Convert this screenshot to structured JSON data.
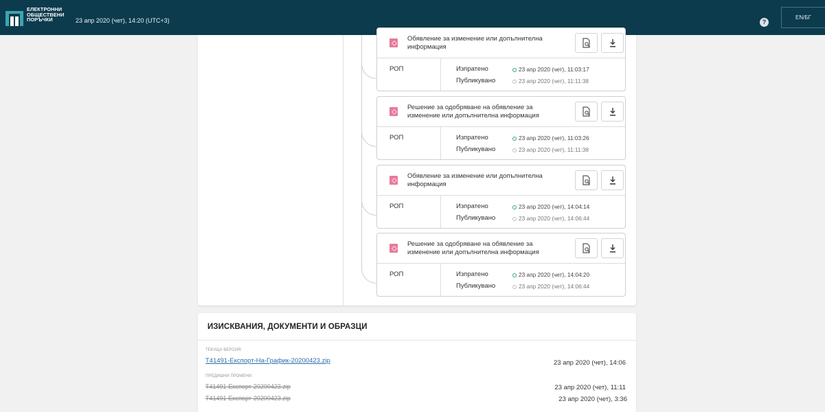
{
  "header": {
    "logo_lines": [
      "ЕЛЕКТРОННИ",
      "ОБЩЕСТВЕНИ",
      "ПОРЪЧКИ"
    ],
    "datetime": "23 апр 2020 (чет), 14:20 (UTC+3)",
    "help_icon": "question-circle-icon",
    "lang": "EN/БГ",
    "bg_color": "#0c3b4d"
  },
  "timeline": {
    "sent_label": "Изпратено",
    "published_label": "Публикувано",
    "documents": [
      {
        "title": "Обявление за изменение или допълнителна информация",
        "org": "РОП",
        "sent": "23 апр 2020 (чет), 11:03:17",
        "published": "23 апр 2020 (чет), 11:11:38"
      },
      {
        "title": "Решение за одобряване на обявление за изменение или допълнителна информация",
        "org": "РОП",
        "sent": "23 апр 2020 (чет), 11:03:26",
        "published": "23 апр 2020 (чет), 11:11:38"
      },
      {
        "title": "Обявление за изменение или допълнителна информация",
        "org": "РОП",
        "sent": "23 апр 2020 (чет), 14:04:14",
        "published": "23 апр 2020 (чет), 14:06:44"
      },
      {
        "title": "Решение за одобряване на обявление за изменение или допълнителна информация",
        "org": "РОП",
        "sent": "23 апр 2020 (чет), 14:04:20",
        "published": "23 апр 2020 (чет), 14:06:44"
      }
    ],
    "icons": {
      "doc": "pdf-icon",
      "preview": "file-preview-icon",
      "download": "download-icon"
    },
    "colors": {
      "pdf": "#e8799a",
      "sent_dot": "#39a56b",
      "published_dot": "#bdbdbd"
    }
  },
  "docs_section": {
    "title": "ИЗИСКВАНИЯ, ДОКУМЕНТИ И ОБРАЗЦИ",
    "current_label": "ТЕКУЩА ВЕРСИЯ:",
    "current": {
      "name": "T41491-Експорт-На-График-20200423.zip",
      "date": "23 апр 2020 (чет), 14:06"
    },
    "previous_label": "ПРЕДИШНИ ПРОМЕНИ:",
    "previous": [
      {
        "name": "T41491-Експорт-20200423.zip",
        "date": "23 апр 2020 (чет), 11:11"
      },
      {
        "name": "T41491-Експорт-20200423.zip",
        "date": "23 апр 2020 (чет), 3:36"
      }
    ]
  }
}
